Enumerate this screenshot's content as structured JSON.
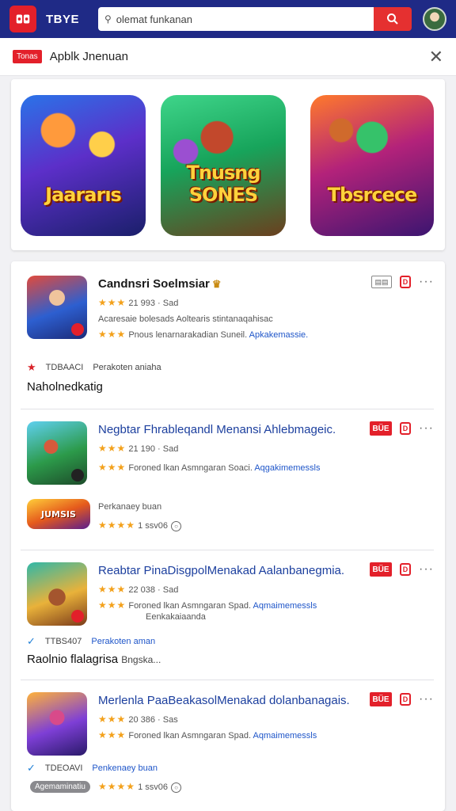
{
  "header": {
    "brand": "TBYE",
    "search_placeholder": "olemat funkanan",
    "icons": [
      "logo-icon",
      "search-icon",
      "avatar-icon"
    ]
  },
  "subheader": {
    "badge": "Tonas",
    "title": "Apblk Jnenuan"
  },
  "featured": [
    {
      "label": "Jaararıs"
    },
    {
      "label": "Tnusng SONES"
    },
    {
      "label": "Tbsrcece"
    }
  ],
  "items": [
    {
      "title": "Candnsri Soelmsiar",
      "rating": "21 993 · Sad",
      "line2": "Acaresaie bolesads Aoltearis stintanaqahisac",
      "line3": "Pnous lenarnarakadian Suneil.",
      "line3_link": "Apkakemassie.",
      "meta_code": "TDBAACI",
      "meta_text": "Perakoten aniaha",
      "tag": "Naholnedkatig"
    },
    {
      "title": "Negbtar Fhrableqandl Menansi Ahlebmageic.",
      "rating": "21 190 · Sad",
      "line2": "Foroned lkan Asmngaran Soaci.",
      "line2_link": "Aqgakimemessls",
      "sub_label": "Perkanaey buan",
      "sub_rating": "1 ssv06",
      "sub_logo": "JUMSIS"
    },
    {
      "title": "Reabtar PinaDisgpolMenakad Aalanbanegmia.",
      "rating": "22 038 · Sad",
      "line2": "Foroned lkan Asmngaran Spad.",
      "line2_link": "Aqmaimemessls",
      "line3": "Eenkakaiaanda",
      "meta_code": "TTBS407",
      "meta_text": "Perakoten aman",
      "tag": "Raolnio flalagrisa",
      "tag_suffix": "Bngska..."
    },
    {
      "title": "Merlenla PaaBeakasolMenakad dolanbanagais.",
      "rating": "20 386 · Sas",
      "line2": "Foroned lkan Asmngaran Spad.",
      "line2_link": "Aqmaimemessls",
      "meta_code": "TDEOAVI",
      "meta_text": "Penkenaey buan",
      "pill": "Agemaminatiu",
      "sub_rating": "1 ssv06"
    }
  ],
  "actions": {
    "red_label": "BÜE",
    "fav_label": "D"
  },
  "colors": {
    "top_bar": "#1f2a86",
    "accent_red": "#e3202a",
    "link_blue": "#1f56c9",
    "title_blue": "#1c3f9e",
    "star": "#f3a11c"
  }
}
